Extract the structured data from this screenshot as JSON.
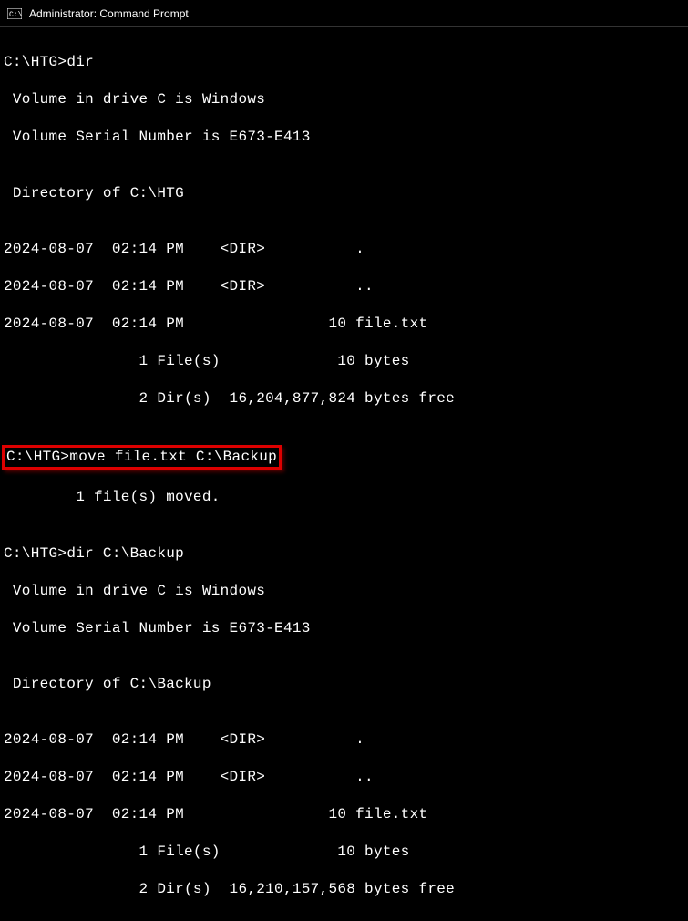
{
  "titlebar": {
    "title": "Administrator: Command Prompt"
  },
  "terminal": {
    "lines": {
      "blank": "",
      "cmd1_prompt": "C:\\HTG>",
      "cmd1_text": "dir",
      "vol1": " Volume in drive C is Windows",
      "serial1": " Volume Serial Number is E673-E413",
      "dirof1": " Directory of C:\\HTG",
      "dir1_r1": "2024-08-07  02:14 PM    <DIR>          .",
      "dir1_r2": "2024-08-07  02:14 PM    <DIR>          ..",
      "dir1_r3": "2024-08-07  02:14 PM                10 file.txt",
      "dir1_s1": "               1 File(s)             10 bytes",
      "dir1_s2": "               2 Dir(s)  16,204,877,824 bytes free",
      "cmd2_prompt": "C:\\HTG>",
      "cmd2_text": "move file.txt C:\\Backup",
      "moved": "        1 file(s) moved.",
      "cmd3_prompt": "C:\\HTG>",
      "cmd3_text": "dir C:\\Backup",
      "vol2": " Volume in drive C is Windows",
      "serial2": " Volume Serial Number is E673-E413",
      "dirof2": " Directory of C:\\Backup",
      "dir2_r1": "2024-08-07  02:14 PM    <DIR>          .",
      "dir2_r2": "2024-08-07  02:14 PM    <DIR>          ..",
      "dir2_r3": "2024-08-07  02:14 PM                10 file.txt",
      "dir2_s1": "               1 File(s)             10 bytes",
      "dir2_s2": "               2 Dir(s)  16,210,157,568 bytes free"
    }
  }
}
